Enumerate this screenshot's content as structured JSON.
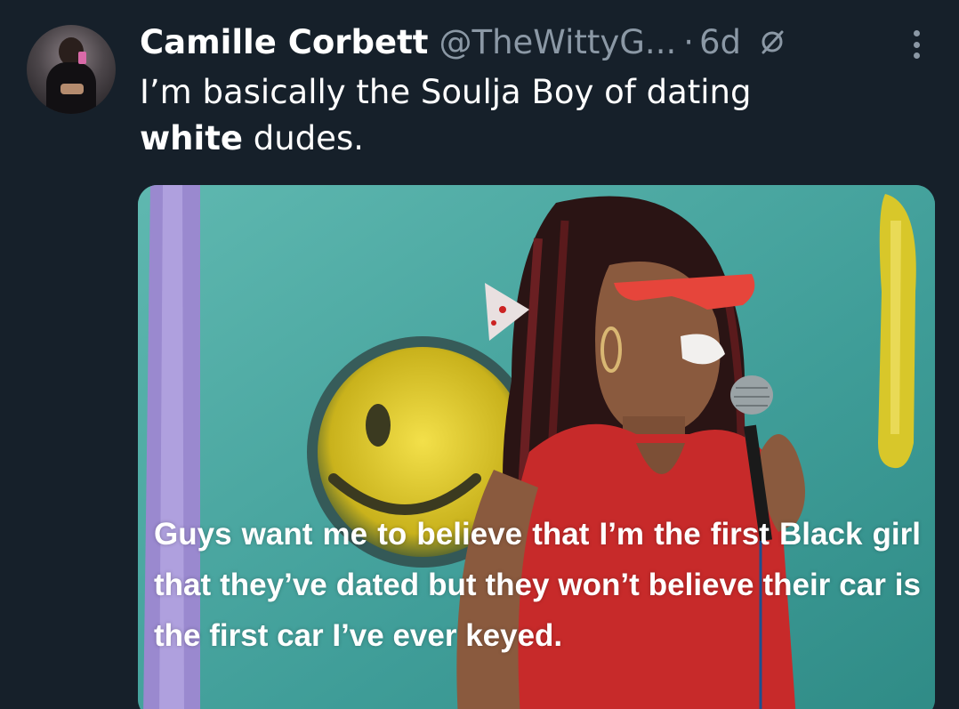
{
  "tweet": {
    "author_name": "Camille Corbett",
    "handle": "@TheWittyG...",
    "separator": "·",
    "time": "6d",
    "text_part1": "I’m basically the Soulja Boy of dating ",
    "text_bold": "white",
    "text_part2": " dudes."
  },
  "media": {
    "caption": "Guys want me to believe that I’m the first Black girl that they’ve dated but they won’t believe their car is the first car I’ve ever keyed."
  },
  "icons": {
    "edit": "edited-icon",
    "more": "more-options-icon"
  },
  "colors": {
    "background": "#16202a",
    "secondary_text": "#8b98a5",
    "primary_text": "#ffffff"
  }
}
